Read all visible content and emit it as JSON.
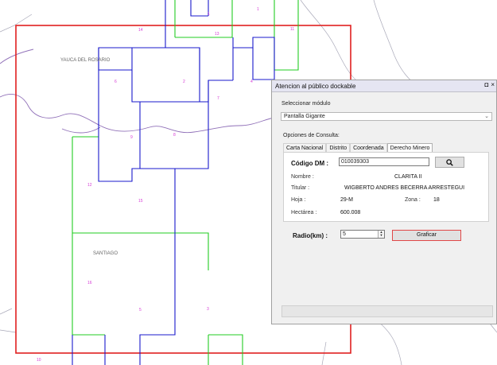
{
  "map": {
    "places": [
      "YAUCA DEL ROSARIO",
      "SANTIAGO"
    ],
    "grid_labels": [
      "14",
      "13",
      "11",
      "6",
      "2",
      "7",
      "4",
      "9",
      "8",
      "12",
      "15",
      "16",
      "5",
      "3",
      "10",
      "1",
      "1"
    ]
  },
  "panel": {
    "title": "Atencion al público dockable",
    "controls": [
      "◘",
      "×"
    ],
    "module_label": "Seleccionar módulo",
    "module_value": "Pantalla Gigante",
    "options_label": "Opciones de Consulta:",
    "tabs": [
      "Carta Nacional",
      "Distrito",
      "Coordenada",
      "Derecho Minero"
    ],
    "active_tab": "Derecho Minero",
    "codigo_label": "Código DM :",
    "codigo_value": "010039303",
    "nombre_label": "Nombre :",
    "nombre_value": "CLARITA II",
    "titular_label": "Titular :",
    "titular_value": "WIGBERTO ANDRES BECERRA ARRESTEGUI",
    "hoja_label": "Hoja :",
    "hoja_value": "29-M",
    "zona_label": "Zona :",
    "zona_value": "18",
    "hectareas_label": "Hectárea :",
    "hectareas_value": "600.008",
    "radio_label": "Radio(km) :",
    "radio_value": "5",
    "graficar_label": "Graficar"
  },
  "colors": {
    "boundary": "#e02020",
    "blocks_blue": "#1a1acc",
    "blocks_green": "#22cc22",
    "rivers": "#9070b8",
    "labels": "#d63ad6"
  },
  "icons": [
    "search-icon",
    "chevron-down-icon",
    "spin-up-icon",
    "spin-down-icon"
  ]
}
